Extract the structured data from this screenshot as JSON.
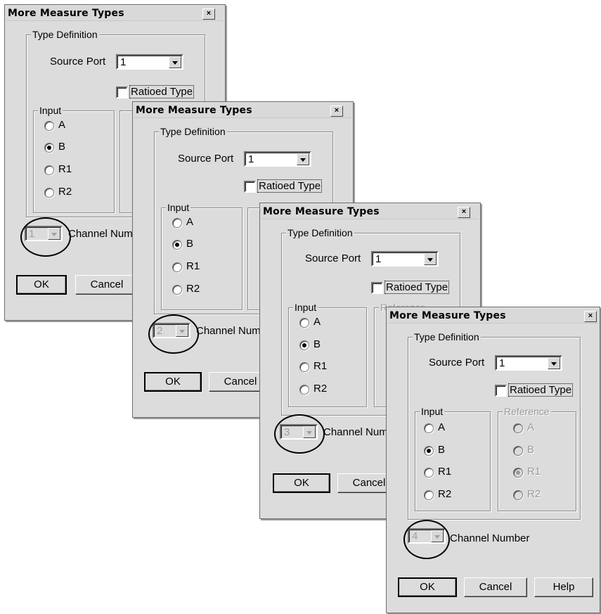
{
  "dialog": {
    "title": "More Measure Types",
    "close": "×",
    "type_definition": "Type Definition",
    "source_port_label": "Source Port",
    "source_port_value": "1",
    "ratioed_label": "Ratioed Type",
    "input_group": "Input",
    "reference_group": "Reference",
    "input_options": [
      "A",
      "B",
      "R1",
      "R2"
    ],
    "reference_options": [
      "A",
      "B",
      "R1",
      "R2"
    ],
    "channel_label": "Channel Number",
    "channel_label_short": "Channel Num",
    "ok": "OK",
    "cancel": "Cancel",
    "help": "Help"
  },
  "windows": [
    {
      "channel": "1",
      "selected_input": "B"
    },
    {
      "channel": "2",
      "selected_input": "B"
    },
    {
      "channel": "3",
      "selected_input": "B"
    },
    {
      "channel": "4",
      "selected_input": "B",
      "selected_reference": "R1"
    }
  ]
}
